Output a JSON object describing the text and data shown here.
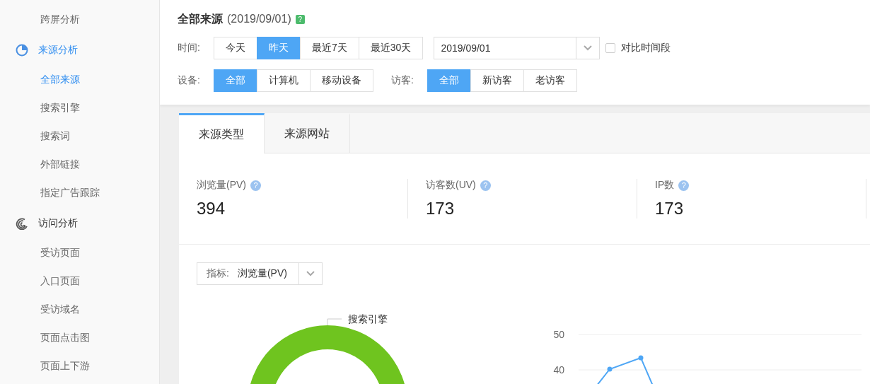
{
  "sidebar": {
    "sections": [
      {
        "children": [
          {
            "label": "跨屏分析",
            "selected": false
          }
        ]
      },
      {
        "title": "来源分析",
        "selected": true,
        "children": [
          {
            "label": "全部来源",
            "selected": true
          },
          {
            "label": "搜索引擎",
            "selected": false
          },
          {
            "label": "搜索词",
            "selected": false
          },
          {
            "label": "外部链接",
            "selected": false
          },
          {
            "label": "指定广告跟踪",
            "selected": false
          }
        ]
      },
      {
        "title": "访问分析",
        "selected": false,
        "children": [
          {
            "label": "受访页面",
            "selected": false
          },
          {
            "label": "入口页面",
            "selected": false
          },
          {
            "label": "受访域名",
            "selected": false
          },
          {
            "label": "页面点击图",
            "selected": false
          },
          {
            "label": "页面上下游",
            "selected": false
          }
        ]
      }
    ]
  },
  "header": {
    "title": "全部来源",
    "date": "(2019/09/01)",
    "help": "?"
  },
  "filters": {
    "time": {
      "label": "时间:",
      "options": [
        {
          "label": "今天",
          "selected": false
        },
        {
          "label": "昨天",
          "selected": true
        },
        {
          "label": "最近7天",
          "selected": false
        },
        {
          "label": "最近30天",
          "selected": false
        }
      ],
      "date_value": "2019/09/01",
      "compare": {
        "label": "对比时间段",
        "checked": false
      }
    },
    "device": {
      "label": "设备:",
      "options": [
        {
          "label": "全部",
          "selected": true
        },
        {
          "label": "计算机",
          "selected": false
        },
        {
          "label": "移动设备",
          "selected": false
        }
      ]
    },
    "visitor": {
      "label": "访客:",
      "options": [
        {
          "label": "全部",
          "selected": true
        },
        {
          "label": "新访客",
          "selected": false
        },
        {
          "label": "老访客",
          "selected": false
        }
      ]
    }
  },
  "tabs": [
    {
      "label": "来源类型",
      "selected": true
    },
    {
      "label": "来源网站",
      "selected": false
    }
  ],
  "stats": [
    {
      "label": "浏览量(PV)",
      "help": "?",
      "value": "394"
    },
    {
      "label": "访客数(UV)",
      "help": "?",
      "value": "173"
    },
    {
      "label": "IP数",
      "help": "?",
      "value": "173"
    }
  ],
  "metric_select": {
    "label": "指标:",
    "value": "浏览量(PV)"
  },
  "donut": {
    "legend": "搜索引擎"
  },
  "line_chart": {
    "y_axis_labels": [
      "50",
      "40"
    ]
  }
}
